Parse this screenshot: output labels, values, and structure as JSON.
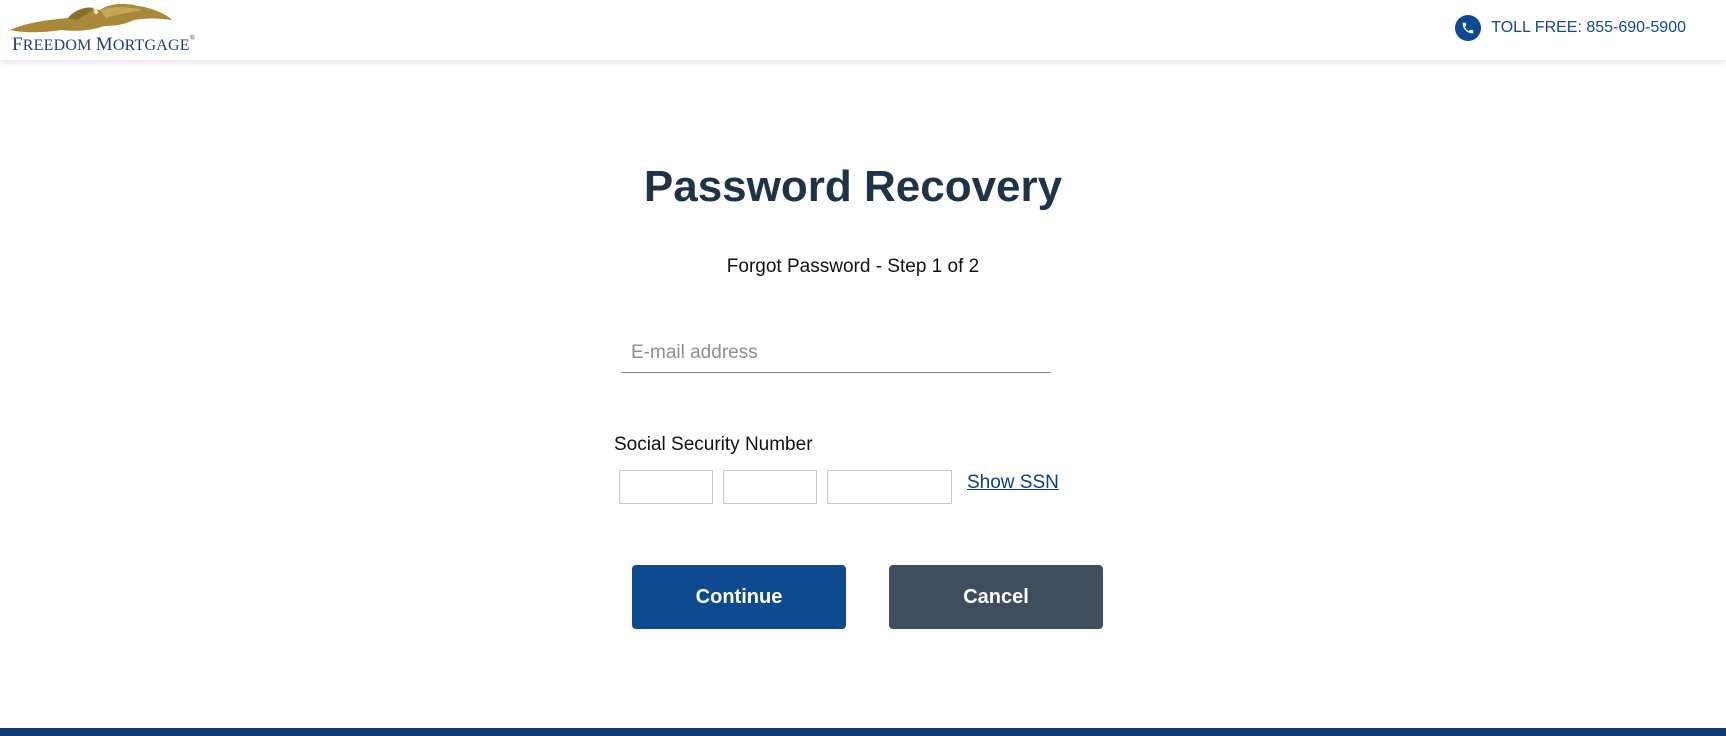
{
  "header": {
    "logo_text_first": "F",
    "logo_text_rest1": "REEDOM ",
    "logo_text_m": "M",
    "logo_text_rest2": "ORTGAGE",
    "logo_reg": "®",
    "phone_text": "TOLL FREE: 855-690-5900"
  },
  "main": {
    "title": "Password Recovery",
    "subtitle": "Forgot Password - Step 1 of 2",
    "email": {
      "placeholder": "E-mail address",
      "value": ""
    },
    "ssn": {
      "label": "Social Security Number",
      "part1": "",
      "part2": "",
      "part3": "",
      "show_label": "Show SSN"
    },
    "buttons": {
      "continue_label": "Continue",
      "cancel_label": "Cancel"
    }
  },
  "icons": {
    "phone": "phone-icon",
    "logo": "eagle-logo-icon"
  },
  "colors": {
    "primary": "#0d4a8f",
    "secondary": "#3f4e5f",
    "title": "#1f3347",
    "logo_gold": "#a8893a",
    "footer": "#0d3a72"
  }
}
